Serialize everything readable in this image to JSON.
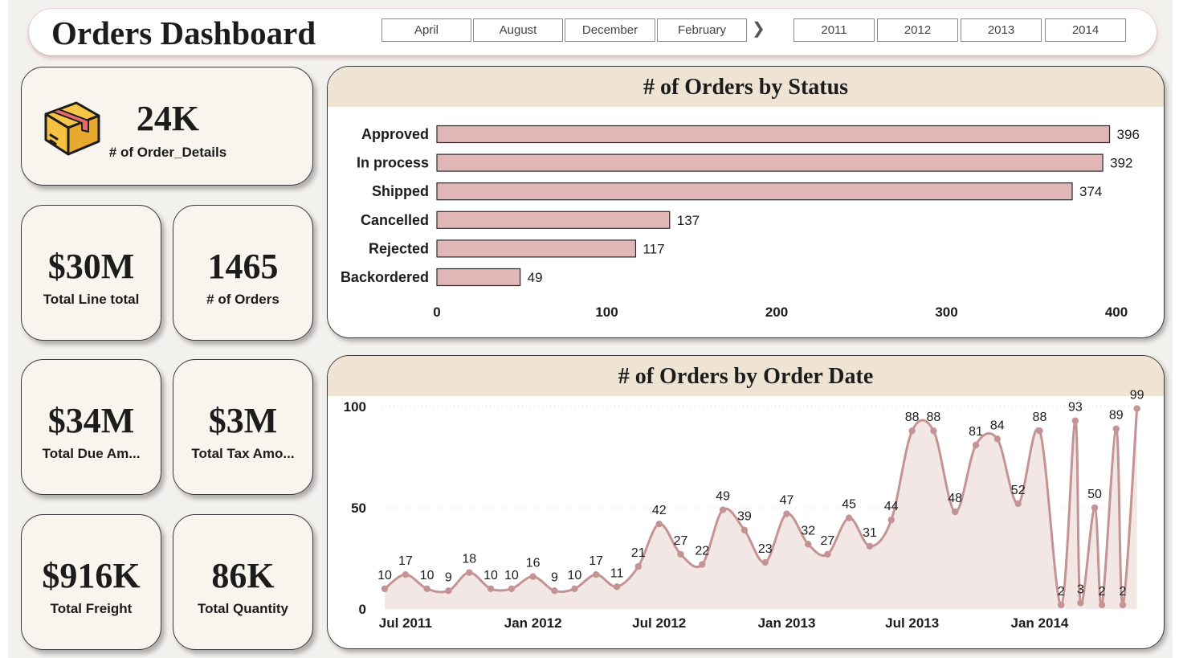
{
  "header": {
    "title": "Orders Dashboard",
    "month_buttons": [
      "April",
      "August",
      "December",
      "February"
    ],
    "year_buttons": [
      "2011",
      "2012",
      "2013",
      "2014"
    ]
  },
  "kpis": {
    "order_details": {
      "value": "24K",
      "label": "# of Order_Details"
    },
    "line_total": {
      "value": "$30M",
      "label": "Total Line total"
    },
    "orders": {
      "value": "1465",
      "label": "# of Orders"
    },
    "due_amount": {
      "value": "$34M",
      "label": "Total Due Am..."
    },
    "tax_amount": {
      "value": "$3M",
      "label": "Total Tax Amo..."
    },
    "freight": {
      "value": "$916K",
      "label": "Total Freight"
    },
    "quantity": {
      "value": "86K",
      "label": "Total Quantity"
    }
  },
  "colors": {
    "bar_fill": "#e0b6b6",
    "line": "#c49494",
    "area": "#f3e7e6",
    "header_band": "#efe4d4",
    "card_bg": "#f8f4ee"
  },
  "icons": {
    "kpi_main": "package-box-icon",
    "slicer_next": "chevron-right-icon"
  },
  "chart_data": [
    {
      "type": "bar",
      "orientation": "horizontal",
      "title": "# of Orders by Status",
      "categories": [
        "Approved",
        "In process",
        "Shipped",
        "Cancelled",
        "Rejected",
        "Backordered"
      ],
      "values": [
        396,
        392,
        374,
        137,
        117,
        49
      ],
      "xlim": [
        0,
        400
      ],
      "ticks": [
        "0",
        "100",
        "200",
        "300",
        "400"
      ],
      "grid": false,
      "data_labels": true
    },
    {
      "type": "line",
      "title": "# of Orders by Order Date",
      "x": [
        "2011-06",
        "2011-07",
        "2011-08",
        "2011-09",
        "2011-10",
        "2011-11",
        "2011-12",
        "2012-01",
        "2012-02",
        "2012-03",
        "2012-04",
        "2012-05",
        "2012-06",
        "2012-07",
        "2012-08",
        "2012-09",
        "2012-10",
        "2012-11",
        "2012-12",
        "2013-01",
        "2013-02",
        "2013-03",
        "2013-04",
        "2013-05",
        "2013-06",
        "2013-07",
        "2013-08",
        "2013-09",
        "2013-10",
        "2013-11",
        "2013-12",
        "2014-01",
        "2014-02",
        "2014-02",
        "2014-03",
        "2014-03",
        "2014-04",
        "2014-04",
        "2014-05",
        "2014-05"
      ],
      "values": [
        10,
        17,
        10,
        9,
        18,
        10,
        10,
        16,
        9,
        10,
        17,
        11,
        21,
        42,
        27,
        22,
        49,
        39,
        23,
        47,
        32,
        27,
        45,
        31,
        44,
        88,
        88,
        48,
        81,
        84,
        52,
        88,
        2,
        93,
        3,
        50,
        2,
        89,
        2,
        99
      ],
      "xticks": [
        "Jul 2011",
        "Jan 2012",
        "Jul 2012",
        "Jan 2013",
        "Jul 2013",
        "Jan 2014"
      ],
      "yticks": [
        "0",
        "50",
        "100"
      ],
      "ylim": [
        0,
        100
      ],
      "area_fill": true,
      "markers": true,
      "data_labels": true,
      "grid": "horizontal dotted"
    }
  ]
}
